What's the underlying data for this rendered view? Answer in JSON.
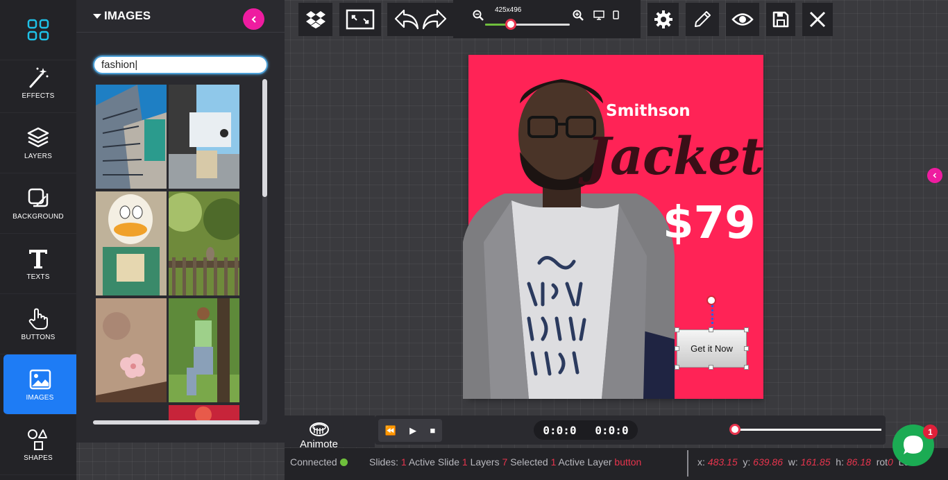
{
  "sidebar": {
    "items": [
      {
        "label": ""
      },
      {
        "label": "EFFECTS"
      },
      {
        "label": "LAYERS"
      },
      {
        "label": "BACKGROUND"
      },
      {
        "label": "TEXTS"
      },
      {
        "label": "BUTTONS"
      },
      {
        "label": "IMAGES"
      },
      {
        "label": "SHAPES"
      }
    ],
    "active_index": 6,
    "accent_color": "#1e7cf5"
  },
  "images_panel": {
    "title": "IMAGES",
    "search_value": "fashion|",
    "thumbnails": [
      "building-photo",
      "boat-harbor-photo",
      "duck-mask-person-photo",
      "cat-on-fence-photo",
      "pink-flower-photo",
      "man-in-park-photo",
      "red-scene-photo"
    ]
  },
  "toolbar": {
    "dropbox_icon": "dropbox-icon",
    "fullscreen_icon": "expand-icon",
    "undo_icon": "undo-icon",
    "redo_icon": "redo-icon",
    "canvas_size": "425x496",
    "zoom_level": 0.3,
    "settings_icon": "gear-icon",
    "edit_icon": "pencil-icon",
    "preview_icon": "eye-icon",
    "save_icon": "floppy-icon",
    "close_icon": "close-icon"
  },
  "design": {
    "background_color": "#ff2356",
    "brand": "Smithson",
    "product": "Jacket",
    "price": "$79",
    "cta_label": "Get it Now"
  },
  "timeline": {
    "logo_text": "Animote",
    "time_current": "0:0:0",
    "time_total": "0:0:0",
    "seek_position": 0
  },
  "status": {
    "connection": "Connected",
    "slides_label": "Slides:",
    "slides_count": "1",
    "active_slide_label": "Active Slide",
    "active_slide_value": "1",
    "layers_label": "Layers",
    "layers_count": "7",
    "selected_label": "Selected",
    "selected_count": "1",
    "active_layer_label": "Active Layer",
    "active_layer_value": "button",
    "x_label": "x:",
    "x_value": "483.15",
    "y_label": "y:",
    "y_value": "639.86",
    "w_label": "w:",
    "w_value": "161.85",
    "h_label": "h:",
    "h_value": "86.18",
    "rotate_label": "rot",
    "rotate_value": "0",
    "trailing_label": "Lo"
  },
  "chat": {
    "badge_count": "1",
    "color": "#1bab53"
  }
}
